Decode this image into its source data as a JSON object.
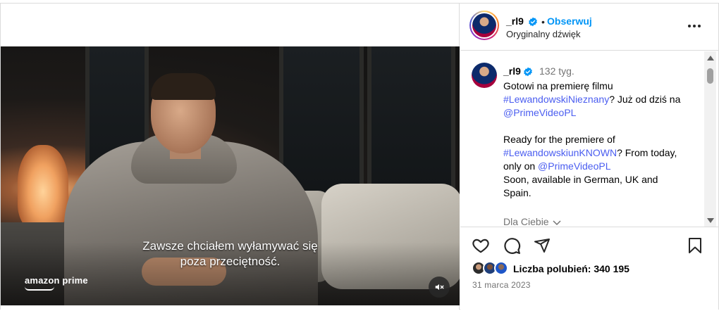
{
  "post": {
    "user": {
      "username": "_rl9",
      "follow_label": "Obserwuj",
      "separator": "•",
      "audio_label": "Oryginalny dźwięk"
    },
    "video": {
      "subtitle_line1": "Zawsze chciałem wyłamywać się",
      "subtitle_line2": "poza przeciętność.",
      "brand": "amazon prime",
      "muted": true
    },
    "caption": {
      "username": "_rl9",
      "time_ago": "132 tyg.",
      "line1_text": "Gotowi na premierę filmu",
      "line2_tag": "#LewandowskiNieznany",
      "line2_text": "? Już od dziś na",
      "line3_tag": "@PrimeVideoPL",
      "line4_text": "Ready for the premiere of",
      "line5_tag": "#LewandowskiunKNOWN",
      "line5_text": "? From today,",
      "line6_text": "only on ",
      "line6_tag": "@PrimeVideoPL",
      "line7_text": "Soon, available in German, UK and",
      "line8_text": "Spain."
    },
    "for_you_label": "Dla Ciebie",
    "likes_label": "Liczba polubień: 340 195",
    "date": "31 marca 2023"
  },
  "colors": {
    "accent": "#0095f6",
    "link": "#4a5df0",
    "muted_text": "#737373",
    "border": "#dbdbdb"
  },
  "icons": [
    "verified-icon",
    "more-options-icon",
    "heart-icon",
    "comment-icon",
    "share-icon",
    "bookmark-icon",
    "mute-icon",
    "chevron-down-icon"
  ]
}
